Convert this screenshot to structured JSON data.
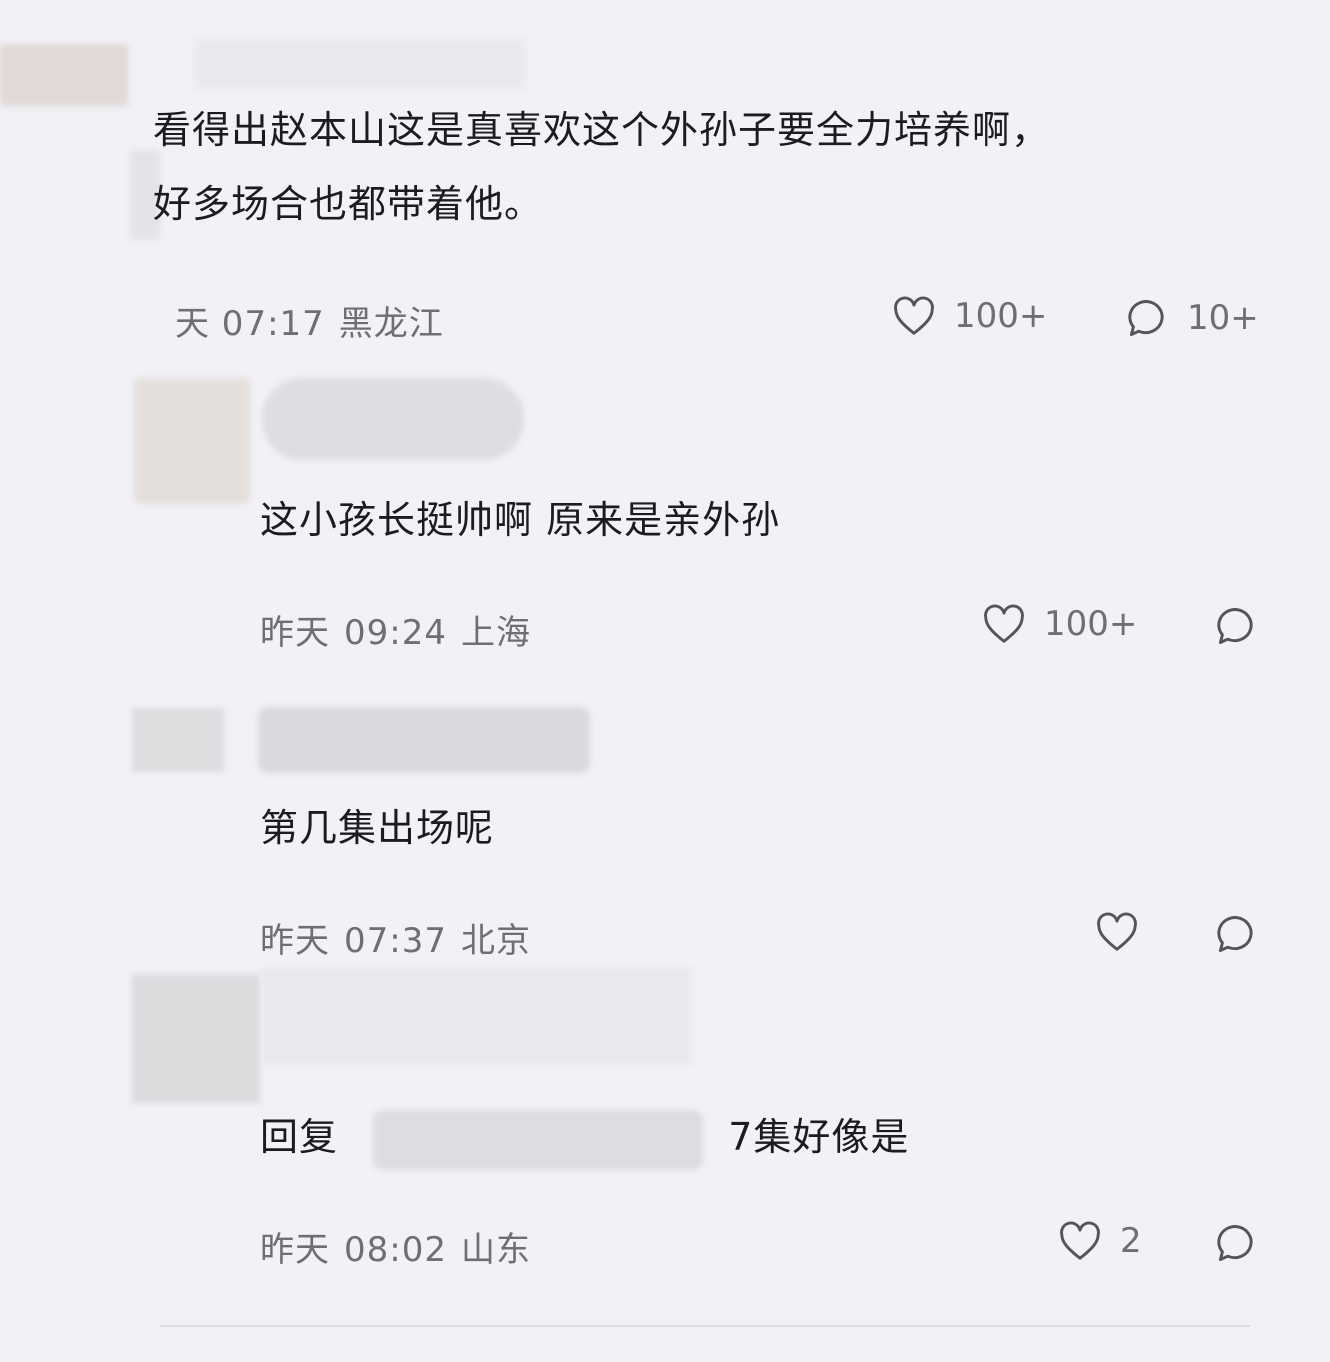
{
  "main_comment": {
    "lines": [
      "看得出赵本山这是真喜欢这个外孙子要全力培养啊，",
      "好多场合也都带着他。"
    ],
    "time": "天 07:17",
    "location": "黑龙江",
    "likes": "100+",
    "replies": "10+"
  },
  "replies": [
    {
      "text": "这小孩长挺帅啊 原来是亲外孙",
      "day": "昨天",
      "time": "09:24",
      "location": "上海",
      "likes": "100+"
    },
    {
      "text": "第几集出场呢",
      "day": "昨天",
      "time": "07:37",
      "location": "北京",
      "likes": ""
    },
    {
      "reply_prefix": "回复",
      "text": "7集好像是",
      "day": "昨天",
      "time": "08:02",
      "location": "山东",
      "likes": "2"
    }
  ],
  "icons": {
    "like": "heart-outline-icon",
    "comment": "speech-bubble-icon"
  },
  "colors": {
    "background": "#f1f1f6",
    "text": "#1c1c1e",
    "meta": "#6e6e73",
    "blur_patch": "#d9d7db"
  }
}
